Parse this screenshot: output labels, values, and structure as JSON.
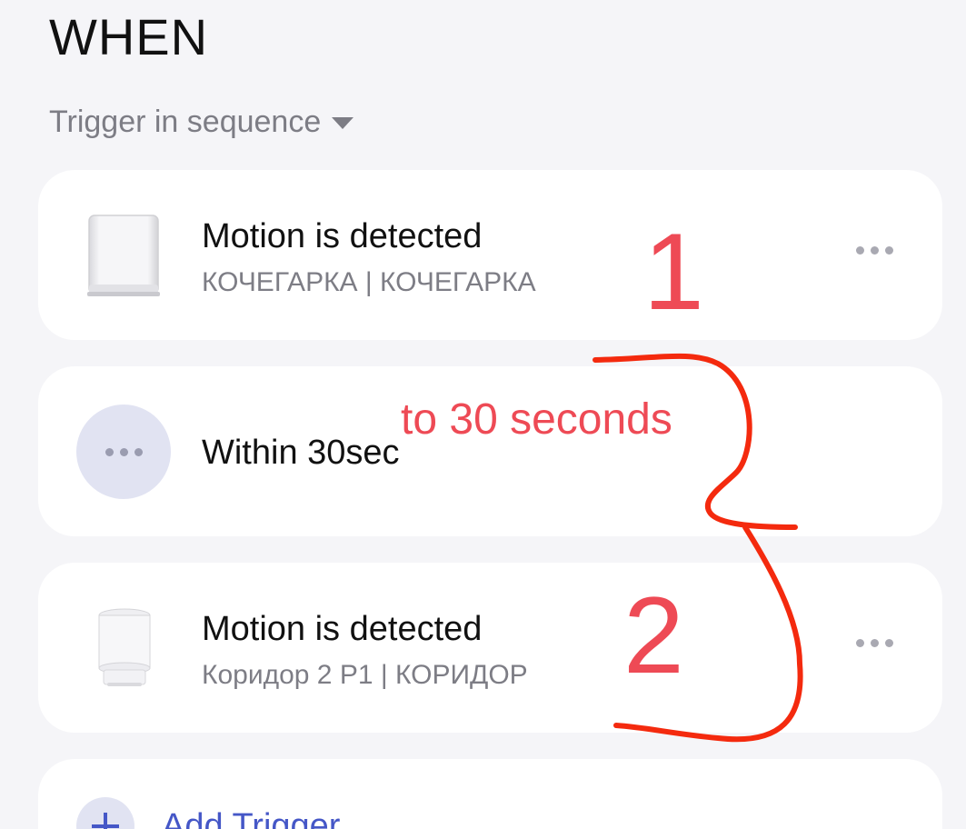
{
  "header": {
    "title": "WHEN",
    "trigger_mode": "Trigger in sequence"
  },
  "triggers": [
    {
      "title": "Motion is detected",
      "subtitle": "КОЧЕГАРКА | КОЧЕГАРКА",
      "icon": "motion-sensor-square-icon"
    },
    {
      "title": "Within 30sec",
      "icon": "more-dots-icon"
    },
    {
      "title": "Motion is detected",
      "subtitle": "Коридор 2 P1 | КОРИДОР",
      "icon": "motion-sensor-p1-icon"
    }
  ],
  "add_trigger": {
    "label": "Add Trigger"
  },
  "annotations": {
    "label_1": "1",
    "label_2": "2",
    "note": "to 30 seconds",
    "color": "#ee4a55"
  },
  "colors": {
    "background": "#f5f5f8",
    "card": "#ffffff",
    "accent": "#4557c7",
    "muted_text": "#7d7d85",
    "annotation_red": "#ee4a55",
    "brace_red": "#f42a0e"
  }
}
